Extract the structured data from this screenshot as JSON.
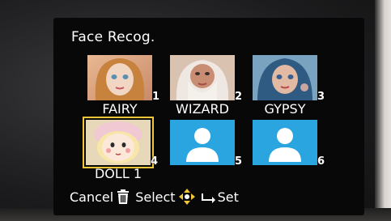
{
  "screen": {
    "title": "Face Recog."
  },
  "faces": [
    {
      "name": "FAIRY",
      "number": "1",
      "registered": true
    },
    {
      "name": "WIZARD",
      "number": "2",
      "registered": true
    },
    {
      "name": "GYPSY",
      "number": "3",
      "registered": true
    },
    {
      "name": "DOLL 1",
      "number": "4",
      "registered": true,
      "selected": true
    },
    {
      "name": "",
      "number": "5",
      "registered": false
    },
    {
      "name": "",
      "number": "6",
      "registered": false
    }
  ],
  "footer": {
    "cancel_label": "Cancel",
    "select_label": "Select",
    "set_label": "Set"
  },
  "colors": {
    "empty_tile": "#2aa5e0",
    "selection_frame": "#f2c73a",
    "text": "#ffffff"
  },
  "icons": {
    "cancel": "trash-icon",
    "select": "dpad-icon",
    "set": "set-arrow-icon",
    "empty_face": "person-silhouette-icon"
  }
}
